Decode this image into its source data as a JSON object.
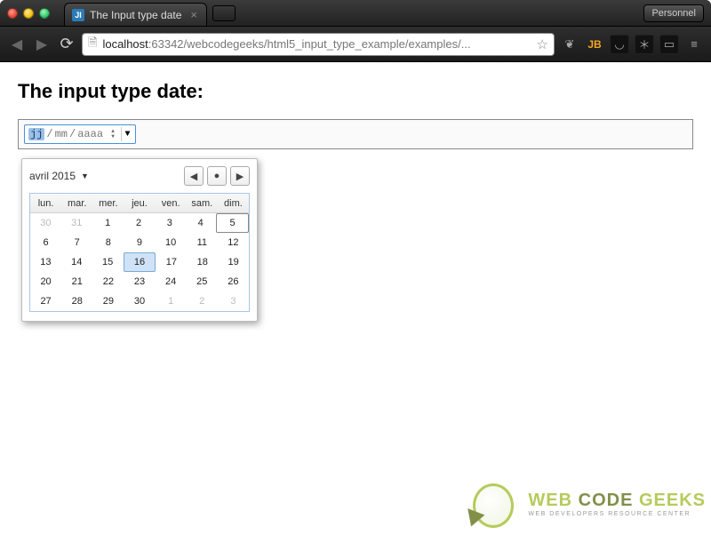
{
  "window": {
    "tab_title": "The Input type date",
    "profile_button": "Personnel"
  },
  "addressbar": {
    "host": "localhost",
    "port_path": ":63342/webcodegeeks/html5_input_type_example/examples/..."
  },
  "page": {
    "heading": "The input type date:"
  },
  "date_input": {
    "placeholder_day": "jj",
    "placeholder_sep": "/",
    "placeholder_month": "mm",
    "placeholder_year": "aaaa"
  },
  "datepicker": {
    "month_label": "avril 2015",
    "nav_prev_glyph": "◀",
    "nav_today_glyph": "●",
    "nav_next_glyph": "▶",
    "weekdays": [
      "lun.",
      "mar.",
      "mer.",
      "jeu.",
      "ven.",
      "sam.",
      "dim."
    ],
    "weeks": [
      [
        {
          "n": 30,
          "muted": true
        },
        {
          "n": 31,
          "muted": true
        },
        {
          "n": 1
        },
        {
          "n": 2
        },
        {
          "n": 3
        },
        {
          "n": 4
        },
        {
          "n": 5,
          "today": true
        }
      ],
      [
        {
          "n": 6
        },
        {
          "n": 7
        },
        {
          "n": 8
        },
        {
          "n": 9
        },
        {
          "n": 10
        },
        {
          "n": 11
        },
        {
          "n": 12
        }
      ],
      [
        {
          "n": 13
        },
        {
          "n": 14
        },
        {
          "n": 15
        },
        {
          "n": 16,
          "selected": true
        },
        {
          "n": 17
        },
        {
          "n": 18
        },
        {
          "n": 19
        }
      ],
      [
        {
          "n": 20
        },
        {
          "n": 21
        },
        {
          "n": 22
        },
        {
          "n": 23
        },
        {
          "n": 24
        },
        {
          "n": 25
        },
        {
          "n": 26
        }
      ],
      [
        {
          "n": 27
        },
        {
          "n": 28
        },
        {
          "n": 29
        },
        {
          "n": 30
        },
        {
          "n": 1,
          "muted": true
        },
        {
          "n": 2,
          "muted": true
        },
        {
          "n": 3,
          "muted": true
        }
      ]
    ]
  },
  "watermark": {
    "line1_a": "WEB ",
    "line1_b": "CODE ",
    "line1_c": "GEEKS",
    "line2": "WEB DEVELOPERS RESOURCE CENTER"
  }
}
